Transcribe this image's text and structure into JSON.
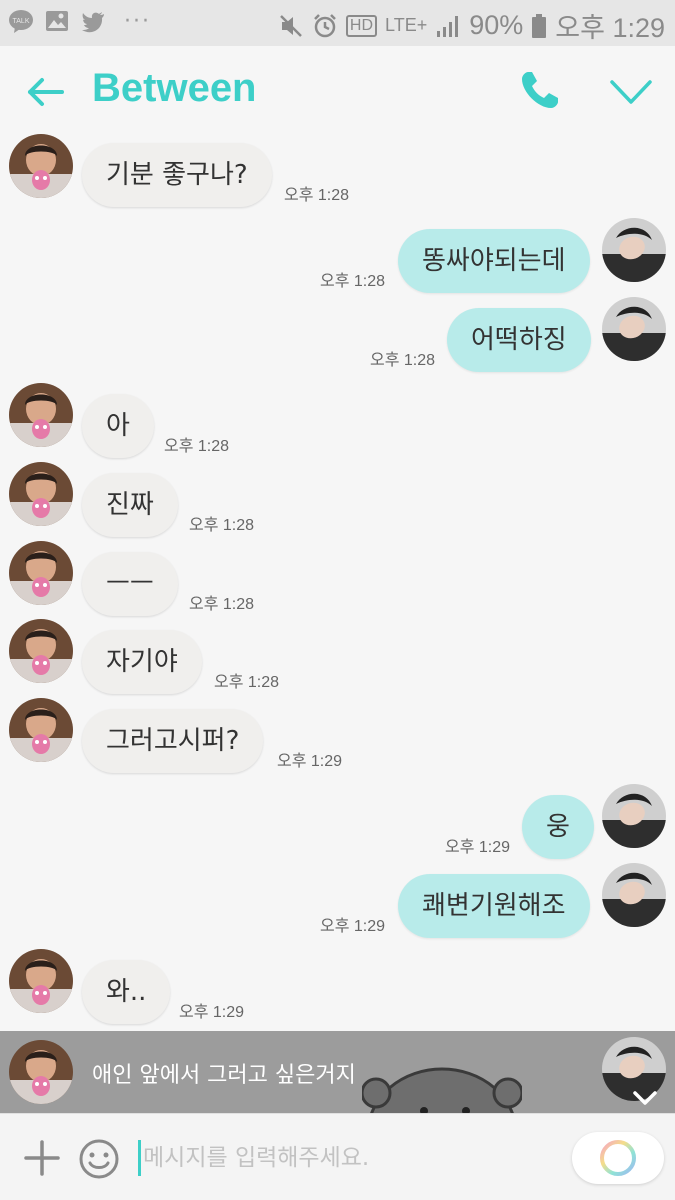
{
  "status_bar": {
    "talk_label": "TALK",
    "dots": "···",
    "hd_label": "HD",
    "lte_label": "LTE+",
    "battery": "90%",
    "time": "오후 1:29"
  },
  "header": {
    "title": "Between",
    "accent_color": "#3dcfc8"
  },
  "messages": [
    {
      "side": "in",
      "text": "기분 좋구나?",
      "time": "오후 1:28"
    },
    {
      "side": "out",
      "text": "똥싸야되는데",
      "time": "오후 1:28"
    },
    {
      "side": "out",
      "text": "어떡하징",
      "time": "오후 1:28"
    },
    {
      "side": "in",
      "text": "아",
      "time": "오후 1:28"
    },
    {
      "side": "in",
      "text": "진짜",
      "time": "오후 1:28"
    },
    {
      "side": "in",
      "text": "ㅡㅡ",
      "time": "오후 1:28"
    },
    {
      "side": "in",
      "text": "자기야",
      "time": "오후 1:28"
    },
    {
      "side": "in",
      "text": "그러고시퍼?",
      "time": "오후 1:29"
    },
    {
      "side": "out",
      "text": "웅",
      "time": "오후 1:29"
    },
    {
      "side": "out",
      "text": "쾌변기원해조",
      "time": "오후 1:29"
    },
    {
      "side": "in",
      "text": "와..",
      "time": "오후 1:29"
    }
  ],
  "preview": {
    "text": "애인 앞에서 그러고 싶은거지"
  },
  "input": {
    "placeholder": "메시지를 입력해주세요."
  },
  "colors": {
    "incoming_bubble": "#f0efed",
    "outgoing_bubble": "#b8ebea"
  }
}
